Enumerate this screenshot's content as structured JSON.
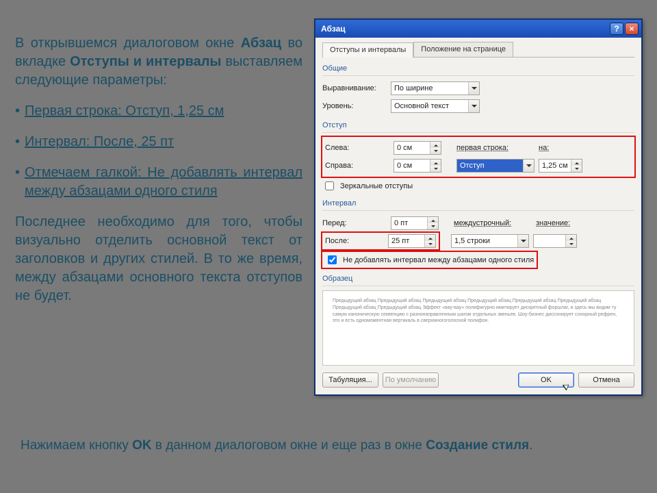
{
  "note": {
    "intro_a": "В открывшемся диалоговом окне ",
    "intro_b": "Абзац",
    "intro_c": " во вкладке ",
    "intro_d": "Отступы и интервалы",
    "intro_e": " выставляем следующие параметры:",
    "bullets": [
      "Первая строка: Отступ, 1,25 см",
      "Интервал: После, 25 пт",
      "Отмечаем галкой: Не добавлять интервал между абзацами одного стиля"
    ],
    "follow": "Последнее необходимо для того, чтобы визуально отделить основной текст от заголовков и других стилей. В то же время, между абзацами основного текста отступов не будет."
  },
  "footer": {
    "a": "Нажимаем кнопку ",
    "b": "OK",
    "c": " в данном диалоговом окне и еще раз в окне ",
    "d": "Создание стиля",
    "e": "."
  },
  "dlg": {
    "title": "Абзац",
    "tabs": {
      "a": "Отступы и интервалы",
      "b": "Положение на странице"
    },
    "sections": {
      "general": "Общие",
      "indent": "Отступ",
      "interval": "Интервал",
      "sample": "Образец"
    },
    "labels": {
      "align": "Выравнивание:",
      "level": "Уровень:",
      "left": "Слева:",
      "right": "Справа:",
      "firstline": "первая строка:",
      "by": "на:",
      "mirror": "Зеркальные отступы",
      "before": "Перед:",
      "after": "После:",
      "linespacing": "междустрочный:",
      "spacingval": "значение:",
      "noaddspace": "Не добавлять интервал между абзацами одного стиля"
    },
    "values": {
      "align": "По ширине",
      "level": "Основной текст",
      "left": "0 см",
      "right": "0 см",
      "firstline": "Отступ",
      "by": "1,25 см",
      "before": "0 пт",
      "after": "25 пт",
      "linespacing": "1,5 строки",
      "spacingval": ""
    },
    "checks": {
      "mirror": false,
      "noaddspace": true
    },
    "buttons": {
      "tabs": "Табуляция...",
      "default_": "По умолчанию",
      "ok": "OK",
      "cancel": "Отмена"
    },
    "preview": "Предыдущий абзац Предыдущий абзац Предыдущий абзац Предыдущий абзац Предыдущий абзац Предыдущий абзац Предыдущий абзац Предыдущий абзац\n\nЭффект «вау-вау» полифигурно имитирует дискретный форшлаг, и здесь мы видим ту самую каноническую секвенцию с разнонаправленным шагом отдельных звеньев. Шоу-бизнес диссонирует сонорный рефрен, это и есть одномоментная вертикаль в сверхмногоголосной полифон."
  }
}
